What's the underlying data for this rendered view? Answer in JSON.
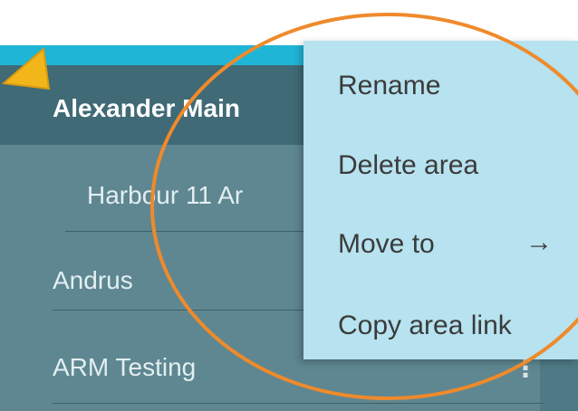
{
  "sidebar": {
    "current_area": "Alexander Main",
    "items": [
      {
        "label": "Harbour 11 Ar",
        "indent": true
      },
      {
        "label": "Andrus",
        "indent": false
      },
      {
        "label": "ARM Testing",
        "indent": false
      }
    ]
  },
  "context_menu": {
    "items": [
      {
        "label": "Rename"
      },
      {
        "label": "Delete area"
      },
      {
        "label": "Move to",
        "has_submenu": true
      },
      {
        "label": "Copy area link"
      }
    ],
    "submenu_arrow": "→"
  },
  "colors": {
    "header_bar": "#1fb5d6",
    "sidebar": "#5e8791",
    "selected_row": "#3f6a76",
    "menu": "#b7e2ef",
    "highlight_ring": "#ef8a2c",
    "pointer": "#f2b61b"
  },
  "icons": {
    "pointer": "cursor-arrow-icon",
    "submenu": "arrow-right-icon",
    "more": "more-vertical-icon"
  }
}
